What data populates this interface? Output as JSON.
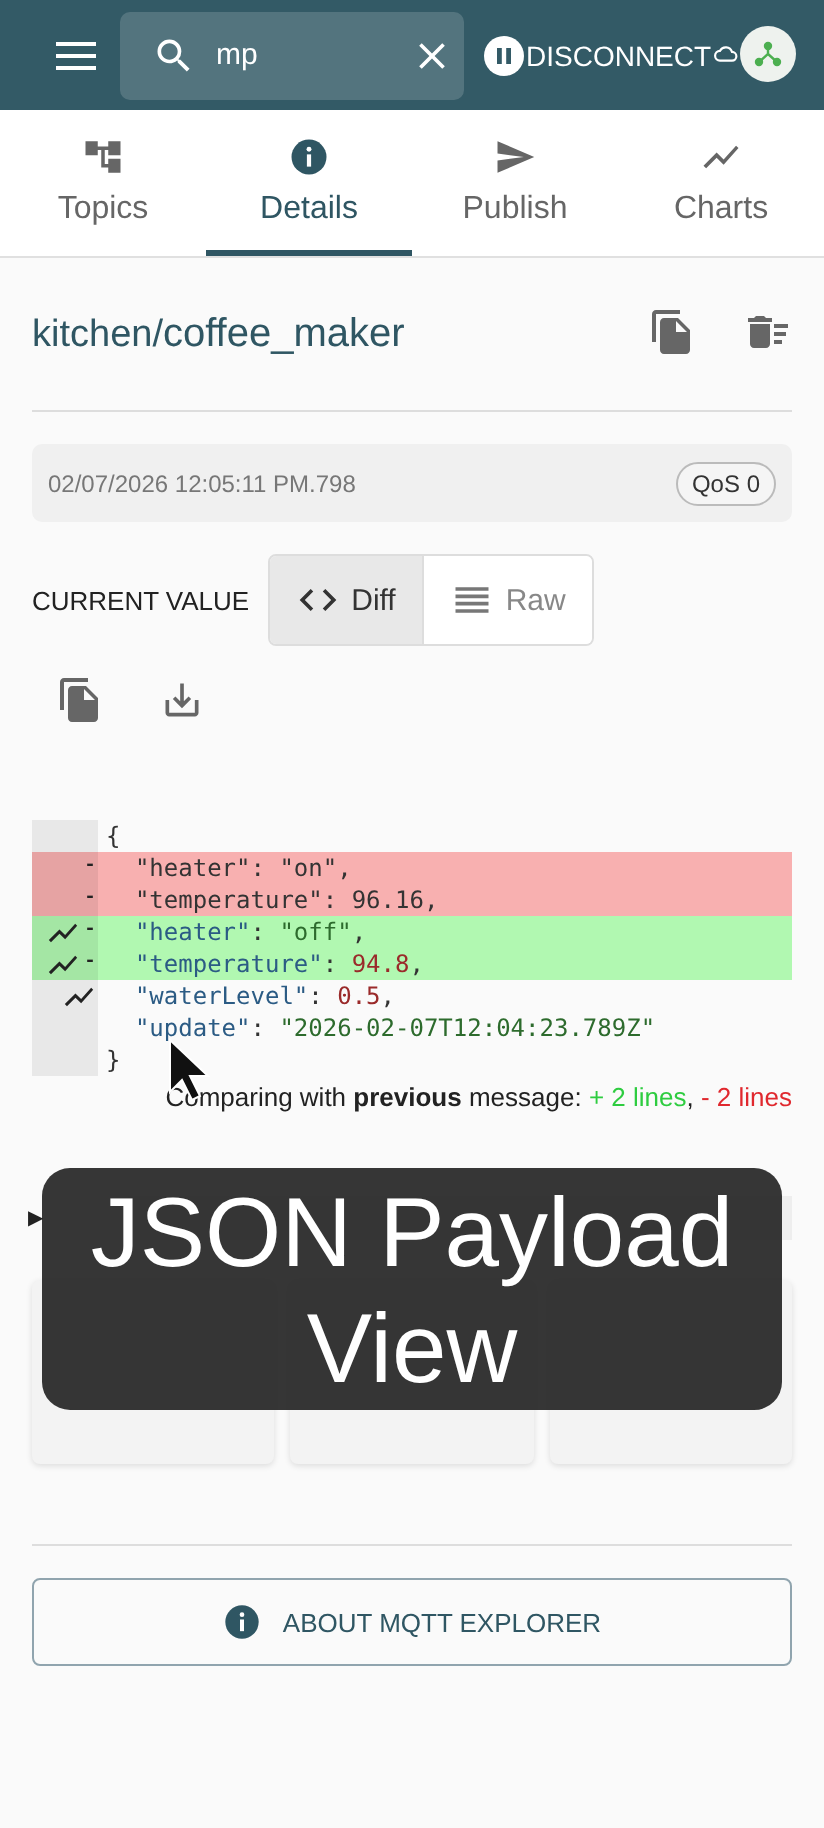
{
  "toolbar": {
    "search": {
      "value": "mp"
    },
    "disconnect_label": "DISCONNECT"
  },
  "tabs": [
    {
      "label": "Topics",
      "selected": false
    },
    {
      "label": "Details",
      "selected": true
    },
    {
      "label": "Publish",
      "selected": false
    },
    {
      "label": "Charts",
      "selected": false
    }
  ],
  "topic": {
    "segments": [
      "kitchen/",
      "coffee_maker"
    ]
  },
  "message": {
    "timestamp": "02/07/2026 12:05:11 PM.798",
    "qos": "QoS 0"
  },
  "current_value": {
    "label": "CURRENT VALUE",
    "modes": [
      {
        "label": "Diff",
        "selected": true
      },
      {
        "label": "Raw",
        "selected": false
      }
    ]
  },
  "diff": {
    "lines": [
      {
        "kind": "context",
        "chart": false,
        "tokens": [
          {
            "kind": "punct",
            "s": "{"
          }
        ]
      },
      {
        "kind": "removed",
        "chart": false,
        "marker": "-",
        "tokens": [
          {
            "kind": "punct",
            "s": "  \"heater\": \"on\","
          }
        ]
      },
      {
        "kind": "removed",
        "chart": false,
        "marker": "-",
        "tokens": [
          {
            "kind": "punct",
            "s": "  \"temperature\": 96.16,"
          }
        ]
      },
      {
        "kind": "added",
        "chart": true,
        "marker": "-",
        "tokens": [
          {
            "kind": "key",
            "s": "  \"heater\""
          },
          {
            "kind": "punct",
            "s": ": "
          },
          {
            "kind": "string",
            "s": "\"off\""
          },
          {
            "kind": "punct",
            "s": ","
          }
        ]
      },
      {
        "kind": "added",
        "chart": true,
        "marker": "-",
        "tokens": [
          {
            "kind": "key",
            "s": "  \"temperature\""
          },
          {
            "kind": "punct",
            "s": ": "
          },
          {
            "kind": "number",
            "s": "94.8"
          },
          {
            "kind": "punct",
            "s": ","
          }
        ]
      },
      {
        "kind": "context",
        "chart": true,
        "tokens": [
          {
            "kind": "key",
            "s": "  \"waterLevel\""
          },
          {
            "kind": "punct",
            "s": ": "
          },
          {
            "kind": "number",
            "s": "0.5"
          },
          {
            "kind": "punct",
            "s": ","
          }
        ]
      },
      {
        "kind": "context",
        "chart": false,
        "tokens": [
          {
            "kind": "key",
            "s": "  \"update\""
          },
          {
            "kind": "punct",
            "s": ": "
          },
          {
            "kind": "string",
            "s": "\"2026-02-07T12:04:23.789Z\""
          }
        ]
      },
      {
        "kind": "context",
        "chart": false,
        "tokens": [
          {
            "kind": "punct",
            "s": "}"
          }
        ]
      }
    ],
    "comparison": "Comparing with **previous** message: ",
    "added": "+ 2 lines",
    "separator": ", ",
    "removed": "- 2 lines"
  },
  "history": {
    "toggle": "▶"
  },
  "about_button": "ABOUT MQTT EXPLORER",
  "caption": "JSON Payload View"
}
